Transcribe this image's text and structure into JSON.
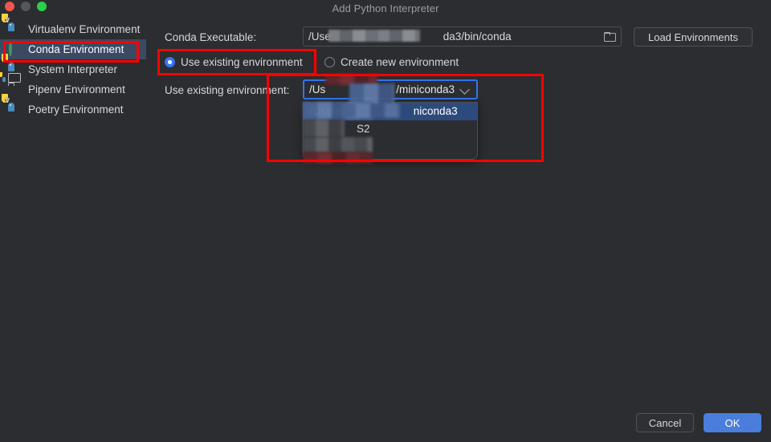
{
  "window": {
    "title": "Add Python Interpreter",
    "traffic_lights": [
      "close-red",
      "minimize-grey",
      "zoom-green"
    ]
  },
  "sidebar": {
    "items": [
      {
        "label": "Virtualenv Environment",
        "icon": "python-venv-icon",
        "selected": false
      },
      {
        "label": "Conda Environment",
        "icon": "conda-ring-icon",
        "selected": true
      },
      {
        "label": "System Interpreter",
        "icon": "python-icon",
        "selected": false
      },
      {
        "label": "Pipenv Environment",
        "icon": "folder-python-icon",
        "selected": false
      },
      {
        "label": "Poetry Environment",
        "icon": "python-venv-icon",
        "selected": false
      }
    ]
  },
  "form": {
    "conda_executable_label": "Conda Executable:",
    "conda_executable_value_start": "/Use",
    "conda_executable_value_end": "da3/bin/conda",
    "load_environments_label": "Load Environments",
    "radio_use_existing_label": "Use existing environment",
    "radio_create_new_label": "Create new environment",
    "radio_selected": "use-existing",
    "use_existing_env_label": "Use existing environment:",
    "combo_value_start": "/Us",
    "combo_value_end": "/miniconda3",
    "combo_chevron": "chevron-down-icon",
    "folder_button": "browse-folder-icon",
    "dropdown_options": [
      {
        "text_start": "/Users",
        "text_end": "niconda3",
        "highlighted": true
      },
      {
        "text_start": "",
        "text_end": "S2",
        "highlighted": false
      },
      {
        "text_start": "",
        "text_end": "",
        "highlighted": false
      }
    ]
  },
  "footer": {
    "cancel_label": "Cancel",
    "ok_label": "OK"
  },
  "colors": {
    "background": "#2b2d30",
    "selection_blue": "#3a4a63",
    "accent_blue": "#3574f0",
    "primary_button": "#4a7ddc",
    "annotation_red": "#ff0000",
    "conda_green": "#3c9a54"
  }
}
